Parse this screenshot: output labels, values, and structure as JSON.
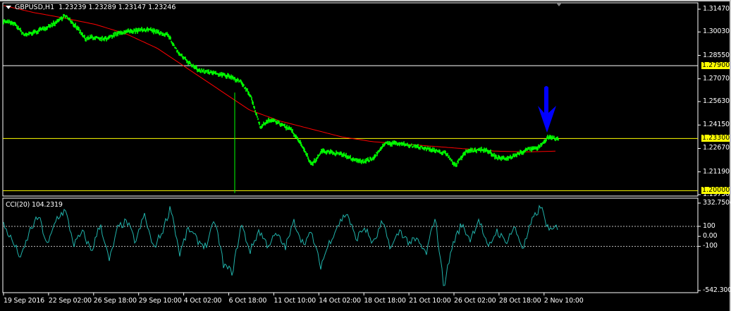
{
  "header": {
    "symbol": "GBPUSD,H1",
    "ohlc": "1.23239 1.23289 1.23147 1.23246"
  },
  "cci": {
    "label": "CCI(20) 104.2319"
  },
  "colors": {
    "price": "#00ff00",
    "ma": "#ff0000",
    "level": "#ffff00",
    "cci": "#20b2aa",
    "arrow": "#0000ff"
  },
  "chart_data": {
    "type": "line",
    "symbol": "GBPUSD",
    "timeframe": "H1",
    "price_axis": {
      "ticks": [
        "1.31470",
        "1.30030",
        "1.28550",
        "1.27070",
        "1.25630",
        "1.24150",
        "1.22670",
        "1.21190",
        "1.19750"
      ],
      "range": [
        1.1975,
        1.3147
      ]
    },
    "levels": [
      {
        "value": 1.279,
        "label": "1.27900",
        "color": "#ffffff"
      },
      {
        "value": 1.233,
        "label": "1.23300",
        "color": "#ffff00"
      },
      {
        "value": 1.2,
        "label": "1.20000",
        "color": "#ffff00"
      }
    ],
    "time_labels": [
      "19 Sep 2016",
      "22 Sep 02:00",
      "26 Sep 18:00",
      "29 Sep 10:00",
      "4 Oct 02:00",
      "6 Oct 18:00",
      "11 Oct 10:00",
      "14 Oct 02:00",
      "18 Oct 18:00",
      "21 Oct 10:00",
      "26 Oct 02:00",
      "28 Oct 18:00",
      "2 Nov 10:00"
    ],
    "price_series": [
      1.3072,
      1.306,
      1.2983,
      1.3,
      1.3027,
      1.306,
      1.3107,
      1.304,
      1.296,
      1.297,
      1.296,
      1.299,
      1.3005,
      1.301,
      1.302,
      1.3,
      1.2985,
      1.2872,
      1.281,
      1.276,
      1.275,
      1.2738,
      1.272,
      1.2694,
      1.2605,
      1.2405,
      1.245,
      1.242,
      1.2383,
      1.2294,
      1.216,
      1.225,
      1.224,
      1.2228,
      1.22,
      1.2183,
      1.2205,
      1.2294,
      1.23,
      1.2294,
      1.228,
      1.2272,
      1.225,
      1.224,
      1.216,
      1.225,
      1.2255,
      1.226,
      1.221,
      1.22,
      1.223,
      1.226,
      1.227,
      1.2339,
      1.2325
    ],
    "ma_series": [
      1.317,
      1.3125,
      1.309,
      1.305,
      1.299,
      1.29,
      1.277,
      1.264,
      1.251,
      1.244,
      1.239,
      1.234,
      1.231,
      1.2295,
      1.228,
      1.2265,
      1.225,
      1.2245,
      1.225
    ],
    "cci_axis": {
      "ticks": [
        "332.7504",
        "100",
        "0.00",
        "-100",
        "-542.3005"
      ],
      "range": [
        -542.3005,
        332.7504
      ],
      "levels": [
        100,
        0,
        -100
      ]
    },
    "cci_series": [
      120,
      -50,
      -220,
      60,
      200,
      -100,
      180,
      260,
      -80,
      40,
      -150,
      130,
      -250,
      90,
      150,
      -60,
      220,
      -120,
      40,
      300,
      -180,
      80,
      -40,
      -100,
      160,
      -290,
      -360,
      120,
      -150,
      60,
      -90,
      20,
      -110,
      150,
      -70,
      30,
      -300,
      -60,
      120,
      240,
      -30,
      90,
      -80,
      140,
      -120,
      60,
      -60,
      -40,
      -180,
      200,
      -500,
      -80,
      120,
      -30,
      180,
      -130,
      60,
      -60,
      90,
      -120,
      150,
      300,
      40,
      104
    ]
  },
  "arrow": {
    "name": "down-arrow"
  }
}
